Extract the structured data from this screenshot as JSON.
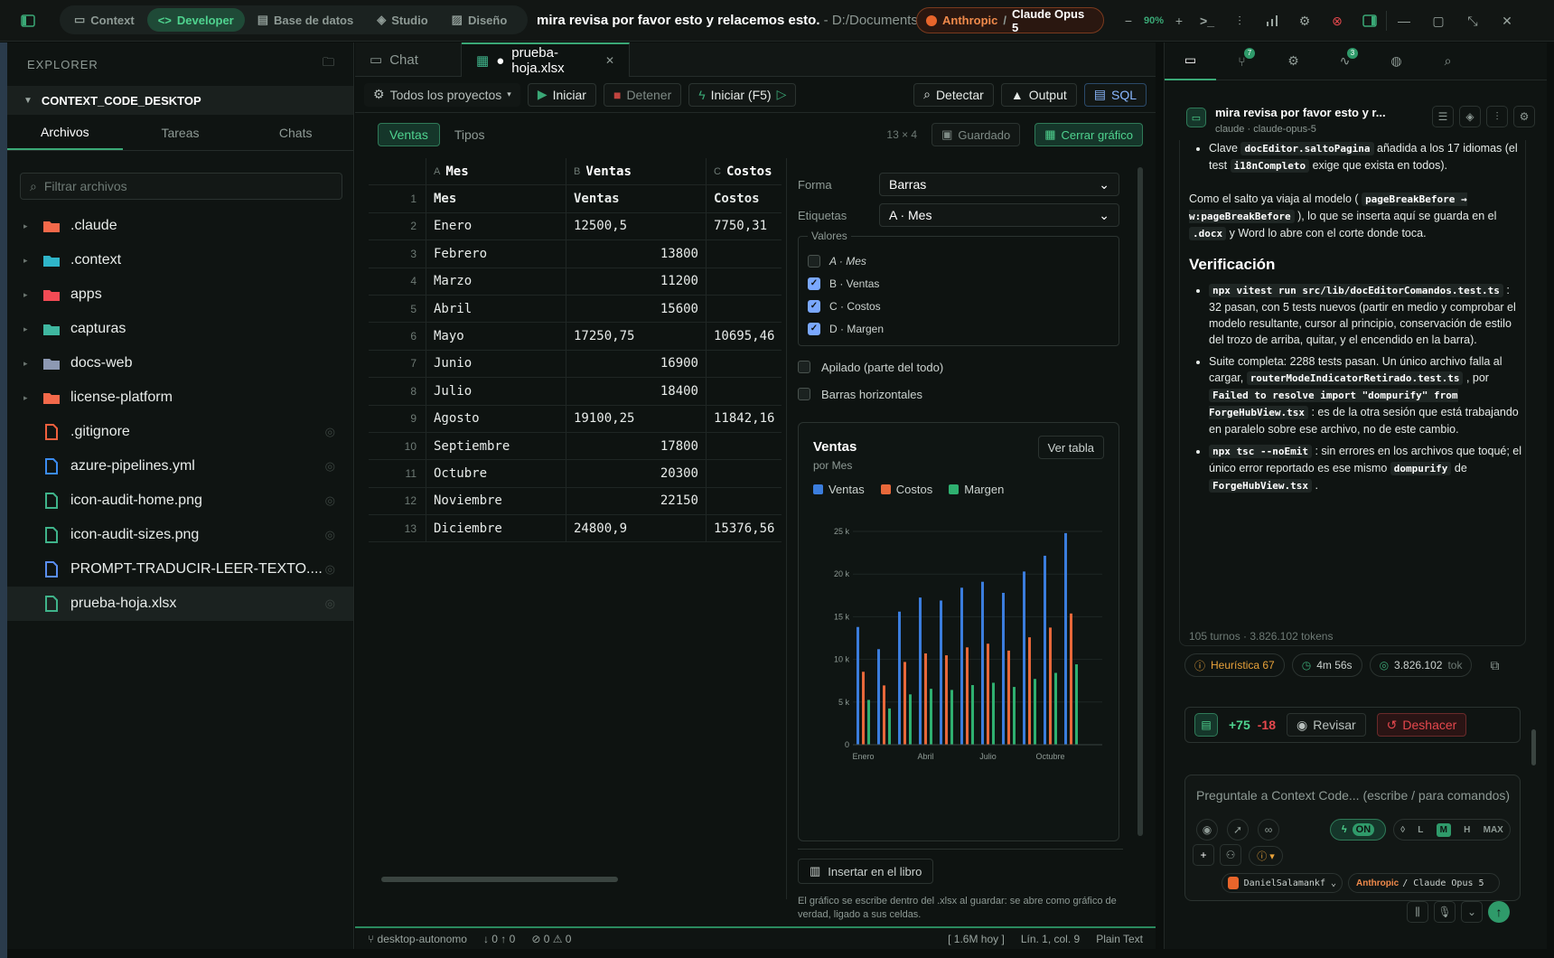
{
  "topnav": {
    "items": [
      {
        "label": "Context"
      },
      {
        "label": "Developer"
      },
      {
        "label": "Base de datos"
      },
      {
        "label": "Studio"
      },
      {
        "label": "Diseño"
      }
    ]
  },
  "window": {
    "title": "mira revisa por favor esto y relacemos esto.",
    "path": " - D:/Documents,",
    "zoom": "90%"
  },
  "model": {
    "provider": "Anthropic",
    "sep": "/",
    "name": "Claude Opus 5"
  },
  "explorer": {
    "header": "EXPLORER",
    "project": "CONTEXT_CODE_DESKTOP",
    "tabs": [
      "Archivos",
      "Tareas",
      "Chats"
    ],
    "filter_placeholder": "Filtrar archivos",
    "items": [
      {
        "name": ".claude",
        "folder": true,
        "color": "#f4694a"
      },
      {
        "name": ".context",
        "folder": true,
        "color": "#2fb5c9"
      },
      {
        "name": "apps",
        "folder": true,
        "color": "#f24b55"
      },
      {
        "name": "capturas",
        "folder": true,
        "color": "#3fb7a0"
      },
      {
        "name": "docs-web",
        "folder": true,
        "color": "#8d99b3"
      },
      {
        "name": "license-platform",
        "folder": true,
        "color": "#f4694a"
      },
      {
        "name": ".gitignore",
        "folder": false,
        "color": "#f0603e"
      },
      {
        "name": "azure-pipelines.yml",
        "folder": false,
        "color": "#3b8cf0"
      },
      {
        "name": "icon-audit-home.png",
        "folder": false,
        "color": "#3fb38a"
      },
      {
        "name": "icon-audit-sizes.png",
        "folder": false,
        "color": "#3fb38a"
      },
      {
        "name": "PROMPT-TRADUCIR-LEER-TEXTO....",
        "folder": false,
        "color": "#5a8ef0"
      },
      {
        "name": "prueba-hoja.xlsx",
        "folder": false,
        "color": "#3fb38a"
      }
    ]
  },
  "editor": {
    "tabs": [
      {
        "label": "Chat"
      },
      {
        "label": "prueba-hoja.xlsx"
      }
    ],
    "toolbar": {
      "projects": "Todos los proyectos",
      "start": "Iniciar",
      "stop": "Detener",
      "run": "Iniciar (F5)",
      "detect": "Detectar",
      "output": "Output",
      "sql": "SQL"
    },
    "sheets": [
      "Ventas",
      "Tipos"
    ],
    "dims": "13 × 4",
    "saved": "Guardado",
    "close_chart": "Cerrar gráfico"
  },
  "sheet": {
    "col_letters": [
      "A",
      "B",
      "C"
    ],
    "col_names": [
      "Mes",
      "Ventas",
      "Costos"
    ],
    "rows": [
      {
        "n": "1",
        "a": "Mes",
        "b": "Ventas",
        "c": "Costos",
        "bn": false
      },
      {
        "n": "2",
        "a": "Enero",
        "b": "12500,5",
        "c": "7750,31",
        "bn": false
      },
      {
        "n": "3",
        "a": "Febrero",
        "b": "13800",
        "c": "",
        "bn": true
      },
      {
        "n": "4",
        "a": "Marzo",
        "b": "11200",
        "c": "",
        "bn": true
      },
      {
        "n": "5",
        "a": "Abril",
        "b": "15600",
        "c": "",
        "bn": true
      },
      {
        "n": "6",
        "a": "Mayo",
        "b": "17250,75",
        "c": "10695,46",
        "bn": false
      },
      {
        "n": "7",
        "a": "Junio",
        "b": "16900",
        "c": "",
        "bn": true
      },
      {
        "n": "8",
        "a": "Julio",
        "b": "18400",
        "c": "",
        "bn": true
      },
      {
        "n": "9",
        "a": "Agosto",
        "b": "19100,25",
        "c": "11842,16",
        "bn": false
      },
      {
        "n": "10",
        "a": "Septiembre",
        "b": "17800",
        "c": "",
        "bn": true
      },
      {
        "n": "11",
        "a": "Octubre",
        "b": "20300",
        "c": "",
        "bn": true
      },
      {
        "n": "12",
        "a": "Noviembre",
        "b": "22150",
        "c": "",
        "bn": true
      },
      {
        "n": "13",
        "a": "Diciembre",
        "b": "24800,9",
        "c": "15376,56",
        "bn": false
      }
    ]
  },
  "chart_settings": {
    "shape_label": "Forma",
    "shape_value": "Barras",
    "labels_label": "Etiquetas",
    "labels_value": "A · Mes",
    "values_legend": "Valores",
    "values": [
      {
        "label": "A · Mes",
        "checked": false
      },
      {
        "label": "B · Ventas",
        "checked": true
      },
      {
        "label": "C · Costos",
        "checked": true
      },
      {
        "label": "D · Margen",
        "checked": true
      }
    ],
    "stacked": "Apilado (parte del todo)",
    "horizontal": "Barras horizontales",
    "insert": "Insertar en el libro",
    "note": "El gráfico se escribe dentro del .xlsx al guardar: se abre como gráfico de verdad, ligado a sus celdas.",
    "view_table": "Ver tabla"
  },
  "chart_data": {
    "type": "bar",
    "title": "Ventas",
    "subtitle": "por Mes",
    "categories": [
      "Enero",
      "Febrero",
      "Marzo",
      "Abril",
      "Mayo",
      "Junio",
      "Julio",
      "Agosto",
      "Septiembre",
      "Octubre",
      "Noviembre",
      "Diciembre"
    ],
    "tick_labels": [
      "Enero",
      "Abril",
      "Julio",
      "Octubre"
    ],
    "y_ticks": [
      "0",
      "5 k",
      "10 k",
      "15 k",
      "20 k",
      "25 k"
    ],
    "ylim": [
      0,
      25000
    ],
    "grid": true,
    "legend_position": "top-left",
    "series": [
      {
        "name": "Ventas",
        "color": "#3b7ddd",
        "values": [
          13800,
          11200,
          15600,
          17250,
          16900,
          18400,
          19100,
          17800,
          20300,
          22150,
          24800,
          0
        ]
      },
      {
        "name": "Costos",
        "color": "#e8683a",
        "values": [
          8550,
          6950,
          9700,
          10700,
          10480,
          11410,
          11840,
          11030,
          12590,
          13730,
          15380,
          0
        ]
      },
      {
        "name": "Margen",
        "color": "#2fb070",
        "values": [
          5250,
          4250,
          5900,
          6550,
          6420,
          6990,
          7260,
          6770,
          7710,
          8420,
          9420,
          0
        ]
      }
    ]
  },
  "status": {
    "branch": "desktop-autonomo",
    "sync": "↓ 0 ↑ 0",
    "problems": "⊘ 0 ⚠ 0",
    "size": "[ 1.6M hoy ]",
    "pos": "Lín. 1, col. 9",
    "lang": "Plain Text"
  },
  "chat": {
    "badges": [
      "7",
      "3"
    ],
    "title": "mira revisa por favor esto y r...",
    "subtitle": "claude · claude-opus-5",
    "li1_pre": "Clave ",
    "li1_code": "docEditor.saltoPagina",
    "li1_mid": " añadida a los 17 idiomas (el test ",
    "li1_code2": "i18nCompleto",
    "li1_post": " exige que exista en todos).",
    "p1_pre": "Como el salto ya viaja al modelo ( ",
    "p1_code": "pageBreakBefore → w:pageBreakBefore",
    "p1_mid": " ), lo que se inserta aquí se guarda en el ",
    "p1_code2": ".docx",
    "p1_post": " y Word lo abre con el corte donde toca.",
    "h_verif": "Verificación",
    "v1_code": "npx vitest run src/lib/docEditorComandos.test.ts",
    "v1_post": " : 32 pasan, con 5 tests nuevos (partir en medio y comprobar el modelo resultante, cursor al principio, conservación de estilo del trozo de arriba, quitar, y el encendido en la barra).",
    "v2_pre": "Suite completa: 2288 tests pasan. Un único archivo falla al cargar, ",
    "v2_code": "routerModeIndicatorRetirado.test.ts",
    "v2_mid": " , por ",
    "v2_code2": "Failed to resolve import \"dompurify\" from ForgeHubView.tsx",
    "v2_post": " : es de la otra sesión que está trabajando en paralelo sobre ese archivo, no de este cambio.",
    "v3_code": "npx tsc --noEmit",
    "v3_mid": " : sin errores en los archivos que toqué; el único error reportado es ese mismo ",
    "v3_code2": "dompurify",
    "v3_mid2": " de ",
    "v3_code3": "ForgeHubView.tsx",
    "v3_post": " .",
    "stats": "105 turnos · 3.826.102 tokens",
    "heur": "Heurística 67",
    "time": "4m 56s",
    "tokens": "3.826.102",
    "tok_unit": "tok",
    "add": "+75",
    "del": "-18",
    "review": "Revisar",
    "undo": "Deshacer",
    "input_placeholder": "Preguntale a Context Code... (escribe / para comandos)",
    "toggle_on": "ON",
    "levels": [
      "L",
      "M",
      "H",
      "MAX"
    ],
    "user": "DanielSalamankf",
    "prov": "Anthropic",
    "model": "/ Claude Opus 5"
  }
}
